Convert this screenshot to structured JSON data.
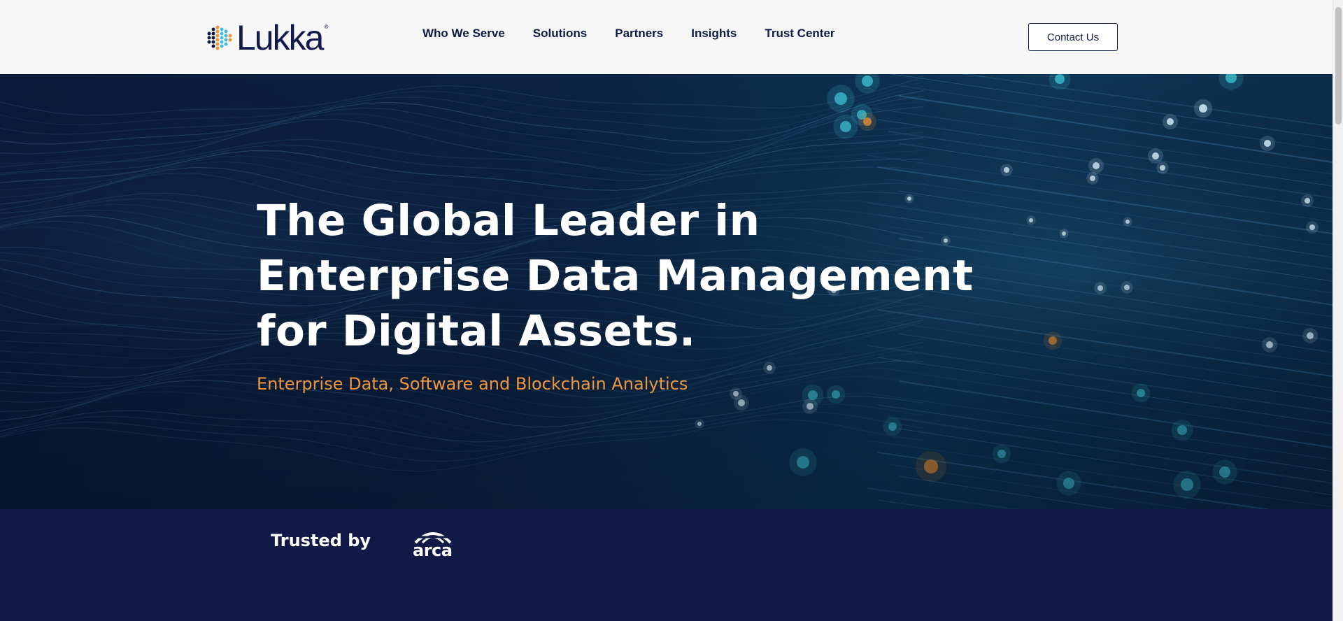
{
  "brand": {
    "name": "Lukka",
    "registered_mark": "®",
    "colors": {
      "navy": "#0f1a45",
      "orange": "#f0953a",
      "teal": "#3fc0d6",
      "band": "#111a47"
    }
  },
  "nav": {
    "items": [
      {
        "label": "Who We Serve"
      },
      {
        "label": "Solutions"
      },
      {
        "label": "Partners"
      },
      {
        "label": "Insights"
      },
      {
        "label": "Trust Center"
      }
    ],
    "contact_label": "Contact Us"
  },
  "hero": {
    "title_lines": [
      "The Global Leader in",
      "Enterprise Data Management",
      "for Digital Assets."
    ],
    "subtitle": "Enterprise Data, Software and Blockchain Analytics"
  },
  "trusted": {
    "label": "Trusted by",
    "partners": [
      {
        "name": "arca"
      }
    ]
  },
  "icons": {
    "logo_mark": "hexagon-dot-cluster-icon",
    "partner_arc": "arch-icon"
  }
}
